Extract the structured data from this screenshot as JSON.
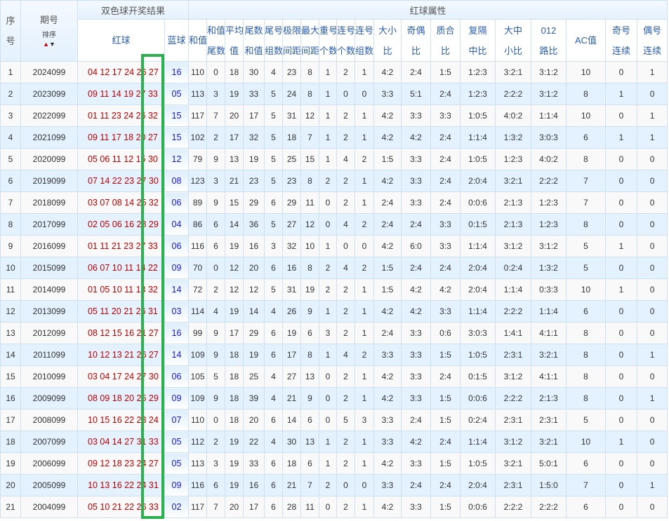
{
  "header": {
    "seq_l1": "序",
    "seq_l2": "号",
    "issue": "期号",
    "sort_label": "排序",
    "result_group": "双色球开奖结果",
    "red": "红球",
    "blue": "蓝球",
    "attr_group": "红球属性",
    "cols": [
      [
        "和值",
        ""
      ],
      [
        "和值",
        "尾数"
      ],
      [
        "平均",
        "值"
      ],
      [
        "尾数",
        "和值"
      ],
      [
        "尾号",
        "组数"
      ],
      [
        "极限",
        "间距"
      ],
      [
        "最大",
        "间距"
      ],
      [
        "重号",
        "个数"
      ],
      [
        "连号",
        "个数"
      ],
      [
        "连号",
        "组数"
      ],
      [
        "大小",
        "比"
      ],
      [
        "奇偶",
        "比"
      ],
      [
        "质合",
        "比"
      ],
      [
        "复隔",
        "中比"
      ],
      [
        "大中",
        "小比"
      ],
      [
        "012",
        "路比"
      ],
      [
        "AC值",
        ""
      ],
      [
        "奇号",
        "连续"
      ],
      [
        "偶号",
        "连续"
      ]
    ]
  },
  "highlight_color": "#2ab04e",
  "rows": [
    [
      "1",
      "2024099",
      "04 12 17 24 26 27",
      "16",
      "110",
      "0",
      "18",
      "30",
      "4",
      "23",
      "8",
      "1",
      "2",
      "1",
      "4:2",
      "2:4",
      "1:5",
      "1:2:3",
      "3:2:1",
      "3:1:2",
      "10",
      "0",
      "1"
    ],
    [
      "2",
      "2023099",
      "09 11 14 19 27 33",
      "05",
      "113",
      "3",
      "19",
      "33",
      "5",
      "24",
      "8",
      "1",
      "0",
      "0",
      "3:3",
      "5:1",
      "2:4",
      "1:2:3",
      "2:2:2",
      "3:1:2",
      "8",
      "1",
      "0"
    ],
    [
      "3",
      "2022099",
      "01 11 23 24 26 32",
      "15",
      "117",
      "7",
      "20",
      "17",
      "5",
      "31",
      "12",
      "1",
      "2",
      "1",
      "4:2",
      "3:3",
      "3:3",
      "1:0:5",
      "4:0:2",
      "1:1:4",
      "10",
      "0",
      "1"
    ],
    [
      "4",
      "2021099",
      "09 11 17 18 20 27",
      "15",
      "102",
      "2",
      "17",
      "32",
      "5",
      "18",
      "7",
      "1",
      "2",
      "1",
      "4:2",
      "4:2",
      "2:4",
      "1:1:4",
      "1:3:2",
      "3:0:3",
      "6",
      "1",
      "1"
    ],
    [
      "5",
      "2020099",
      "05 06 11 12 15 30",
      "12",
      "79",
      "9",
      "13",
      "19",
      "5",
      "25",
      "15",
      "1",
      "4",
      "2",
      "1:5",
      "3:3",
      "2:4",
      "1:0:5",
      "1:2:3",
      "4:0:2",
      "8",
      "0",
      "0"
    ],
    [
      "6",
      "2019099",
      "07 14 22 23 27 30",
      "08",
      "123",
      "3",
      "21",
      "23",
      "5",
      "23",
      "8",
      "2",
      "2",
      "1",
      "4:2",
      "3:3",
      "2:4",
      "2:0:4",
      "3:2:1",
      "2:2:2",
      "7",
      "0",
      "0"
    ],
    [
      "7",
      "2018099",
      "03 07 08 14 25 32",
      "06",
      "89",
      "9",
      "15",
      "29",
      "6",
      "29",
      "11",
      "0",
      "2",
      "1",
      "2:4",
      "3:3",
      "2:4",
      "0:0:6",
      "2:1:3",
      "1:2:3",
      "7",
      "0",
      "0"
    ],
    [
      "8",
      "2017099",
      "02 05 06 16 28 29",
      "04",
      "86",
      "6",
      "14",
      "36",
      "5",
      "27",
      "12",
      "0",
      "4",
      "2",
      "2:4",
      "2:4",
      "3:3",
      "0:1:5",
      "2:1:3",
      "1:2:3",
      "8",
      "0",
      "0"
    ],
    [
      "9",
      "2016099",
      "01 11 21 23 27 33",
      "06",
      "116",
      "6",
      "19",
      "16",
      "3",
      "32",
      "10",
      "1",
      "0",
      "0",
      "4:2",
      "6:0",
      "3:3",
      "1:1:4",
      "3:1:2",
      "3:1:2",
      "5",
      "1",
      "0"
    ],
    [
      "10",
      "2015099",
      "06 07 10 11 14 22",
      "09",
      "70",
      "0",
      "12",
      "20",
      "6",
      "16",
      "8",
      "2",
      "4",
      "2",
      "1:5",
      "2:4",
      "2:4",
      "2:0:4",
      "0:2:4",
      "1:3:2",
      "5",
      "0",
      "0"
    ],
    [
      "11",
      "2014099",
      "01 05 10 11 13 32",
      "14",
      "72",
      "2",
      "12",
      "12",
      "5",
      "31",
      "19",
      "2",
      "2",
      "1",
      "1:5",
      "4:2",
      "4:2",
      "2:0:4",
      "1:1:4",
      "0:3:3",
      "10",
      "1",
      "0"
    ],
    [
      "12",
      "2013099",
      "05 11 20 21 26 31",
      "03",
      "114",
      "4",
      "19",
      "14",
      "4",
      "26",
      "9",
      "1",
      "2",
      "1",
      "4:2",
      "4:2",
      "3:3",
      "1:1:4",
      "2:2:2",
      "1:1:4",
      "6",
      "0",
      "0"
    ],
    [
      "13",
      "2012099",
      "08 12 15 16 21 27",
      "16",
      "99",
      "9",
      "17",
      "29",
      "6",
      "19",
      "6",
      "3",
      "2",
      "1",
      "2:4",
      "3:3",
      "0:6",
      "3:0:3",
      "1:4:1",
      "4:1:1",
      "8",
      "0",
      "0"
    ],
    [
      "14",
      "2011099",
      "10 12 13 21 26 27",
      "14",
      "109",
      "9",
      "18",
      "19",
      "6",
      "17",
      "8",
      "1",
      "4",
      "2",
      "3:3",
      "3:3",
      "1:5",
      "1:0:5",
      "2:3:1",
      "3:2:1",
      "8",
      "0",
      "1"
    ],
    [
      "15",
      "2010099",
      "03 04 17 24 27 30",
      "06",
      "105",
      "5",
      "18",
      "25",
      "4",
      "27",
      "13",
      "0",
      "2",
      "1",
      "4:2",
      "3:3",
      "2:4",
      "0:1:5",
      "3:1:2",
      "4:1:1",
      "8",
      "0",
      "0"
    ],
    [
      "16",
      "2009099",
      "08 09 18 20 25 29",
      "09",
      "109",
      "9",
      "18",
      "39",
      "4",
      "21",
      "9",
      "0",
      "2",
      "1",
      "4:2",
      "3:3",
      "1:5",
      "0:0:6",
      "2:2:2",
      "2:1:3",
      "8",
      "0",
      "1"
    ],
    [
      "17",
      "2008099",
      "10 15 16 22 23 24",
      "07",
      "110",
      "0",
      "18",
      "20",
      "6",
      "14",
      "6",
      "0",
      "5",
      "3",
      "3:3",
      "2:4",
      "1:5",
      "0:2:4",
      "2:3:1",
      "2:3:1",
      "5",
      "0",
      "0"
    ],
    [
      "18",
      "2007099",
      "03 04 14 27 31 33",
      "05",
      "112",
      "2",
      "19",
      "22",
      "4",
      "30",
      "13",
      "1",
      "2",
      "1",
      "3:3",
      "4:2",
      "2:4",
      "1:1:4",
      "3:1:2",
      "3:2:1",
      "10",
      "1",
      "0"
    ],
    [
      "19",
      "2006099",
      "09 12 18 23 24 27",
      "05",
      "113",
      "3",
      "19",
      "33",
      "6",
      "18",
      "6",
      "1",
      "2",
      "1",
      "4:2",
      "3:3",
      "1:5",
      "1:0:5",
      "3:2:1",
      "5:0:1",
      "6",
      "0",
      "0"
    ],
    [
      "20",
      "2005099",
      "10 13 16 22 24 31",
      "09",
      "116",
      "6",
      "19",
      "16",
      "6",
      "21",
      "7",
      "2",
      "0",
      "0",
      "3:3",
      "2:4",
      "2:4",
      "2:0:4",
      "2:3:1",
      "1:5:0",
      "7",
      "0",
      "1"
    ],
    [
      "21",
      "2004099",
      "05 10 21 22 26 33",
      "02",
      "117",
      "7",
      "20",
      "17",
      "6",
      "28",
      "11",
      "0",
      "2",
      "1",
      "4:2",
      "3:3",
      "1:5",
      "0:0:6",
      "2:2:2",
      "2:2:2",
      "6",
      "0",
      "0"
    ]
  ]
}
